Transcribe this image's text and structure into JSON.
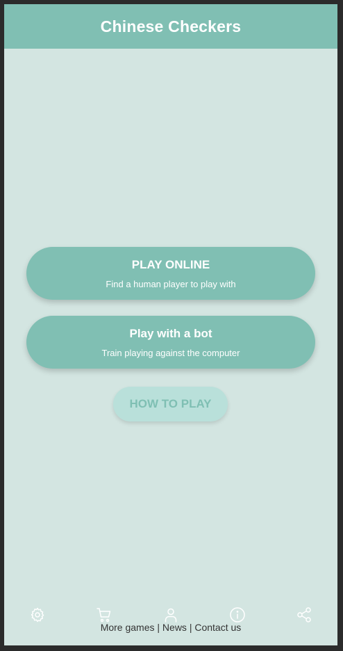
{
  "header": {
    "title": "Chinese Checkers"
  },
  "menu": {
    "play_online": {
      "label": "PLAY ONLINE",
      "subtitle": "Find a human player to play with"
    },
    "play_bot": {
      "label": "Play with a bot",
      "subtitle": "Train playing against the computer"
    },
    "how_to_play": {
      "label": "HOW TO PLAY"
    }
  },
  "bottom_bar": {
    "icons": [
      "gear-icon",
      "cart-icon",
      "user-icon",
      "info-icon",
      "share-icon"
    ]
  },
  "footer": {
    "more_games": "More games",
    "separator": "|",
    "news": "News",
    "contact": "Contact us"
  },
  "colors": {
    "accent": "#80bfb3",
    "background": "#d3e5e1",
    "secondary_button": "#b9e0da"
  }
}
